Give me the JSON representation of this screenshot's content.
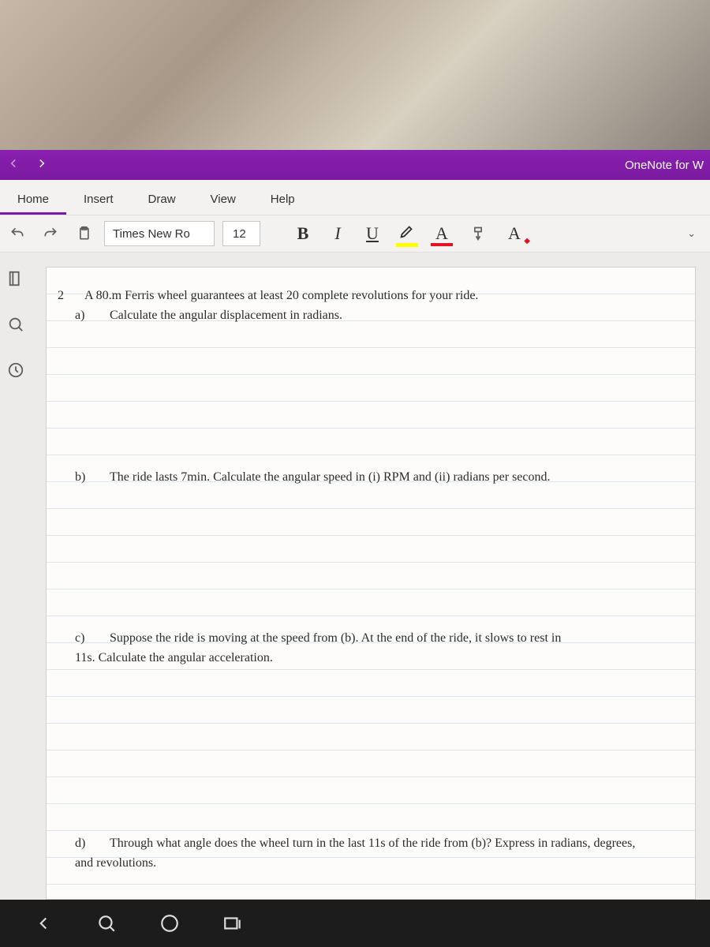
{
  "titleBar": {
    "appName": "OneNote for W"
  },
  "tabs": {
    "home": "Home",
    "insert": "Insert",
    "draw": "Draw",
    "view": "View",
    "help": "Help"
  },
  "toolbar": {
    "fontName": "Times New Ro",
    "fontSize": "12",
    "bold": "B",
    "italic": "I",
    "underline": "U",
    "highlightLabel": "A",
    "fontColorLabel": "A",
    "clearFormat": "A"
  },
  "document": {
    "questionNumber": "2",
    "partA": {
      "label": "a)",
      "line1": "A 80.m Ferris wheel guarantees at least 20 complete revolutions for your ride.",
      "line2": "Calculate the angular displacement in radians."
    },
    "partB": {
      "label": "b)",
      "text": "The ride lasts 7min.  Calculate the angular speed in (i) RPM and (ii) radians per second."
    },
    "partC": {
      "label": "c)",
      "line1": "Suppose the ride is moving at the speed from (b).  At the end of the ride, it slows to rest in",
      "line2": "11s.  Calculate the angular acceleration."
    },
    "partD": {
      "label": "d)",
      "line1": "Through what angle does the wheel turn in the last 11s of the ride from (b)?  Express in radians, degrees,",
      "line2": "and revolutions."
    }
  }
}
